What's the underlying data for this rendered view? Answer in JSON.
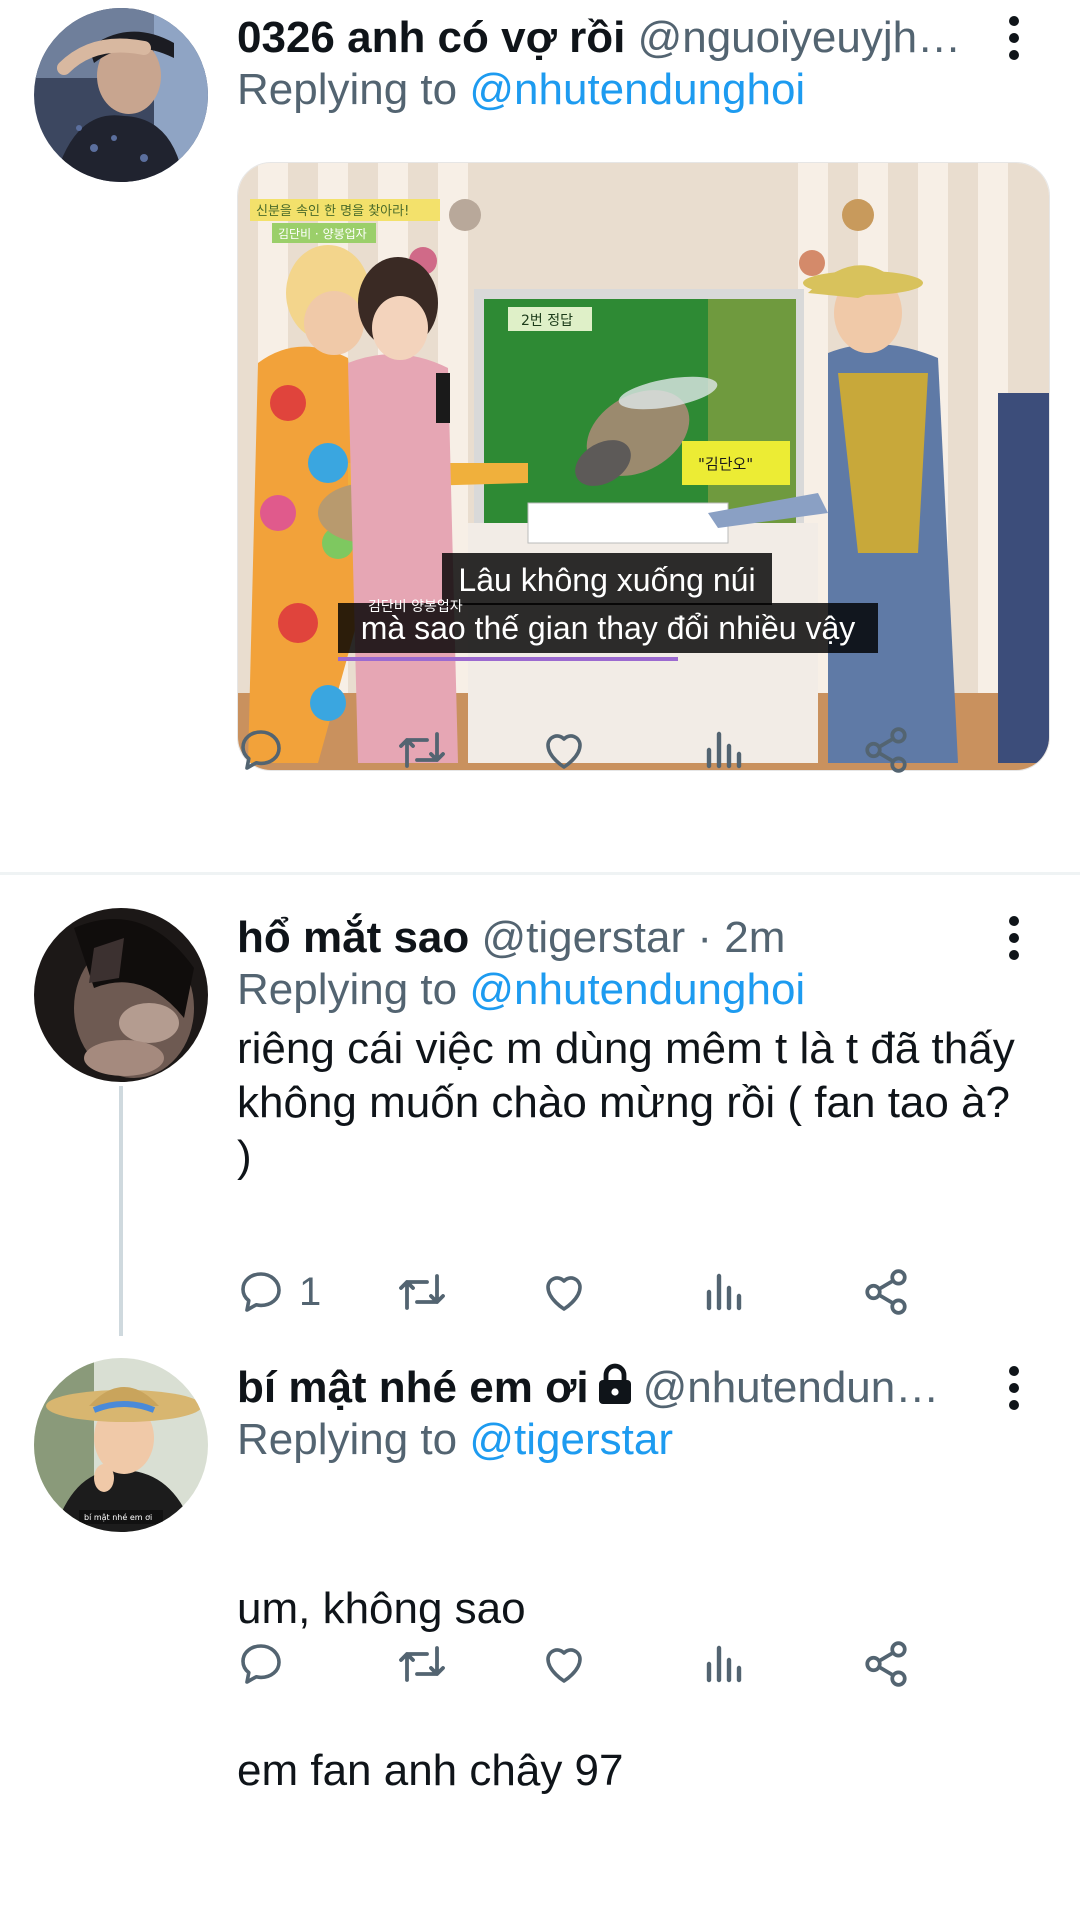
{
  "colors": {
    "accent": "#1d9bf0",
    "muted": "#536471",
    "text": "#0f1419",
    "thread_line": "#cfd9de"
  },
  "tweets": [
    {
      "name": "0326 anh có vợ rồi",
      "handle": "@nguoiyeuyjh…",
      "meta": "",
      "replying_prefix": "Replying to ",
      "replying_to": "@nhutendunghoi",
      "text": "",
      "media": {
        "caption_top_korean": "신분을 속인 한 명을 찾아라!",
        "caption_names_korean": "김단비 · 양봉업자",
        "board_label": "2번 정답",
        "board_card": "\"김단오\"",
        "small_caption": "김단비 양봉업자",
        "subtitle_line1": "Lâu không xuống núi",
        "subtitle_line2": "mà sao thế gian thay đổi nhiều vậy"
      },
      "actions": {
        "reply": "",
        "retweet": "",
        "like": "",
        "views": "",
        "share": ""
      }
    },
    {
      "name": "hổ mắt sao",
      "handle": "@tigerstar",
      "meta": " · 2m",
      "replying_prefix": "Replying to ",
      "replying_to": "@nhutendunghoi",
      "text": "riêng cái việc m dùng mêm t là t đã thấy không muốn chào mừng rồi ( fan tao à? )",
      "actions": {
        "reply": "1",
        "retweet": "",
        "like": "",
        "views": "",
        "share": ""
      }
    },
    {
      "name": "bí mật nhé em ơi",
      "handle": "@nhutendun…",
      "meta": "",
      "lock_icon": "lock-icon",
      "replying_prefix": "Replying to ",
      "replying_to": "@tigerstar",
      "text_line1": "um, không sao",
      "text_line2": "em fan anh chây 97",
      "avatar_caption": "bí mật nhé em ơi",
      "actions": {
        "reply": "",
        "retweet": "",
        "like": "",
        "views": "",
        "share": ""
      }
    }
  ]
}
